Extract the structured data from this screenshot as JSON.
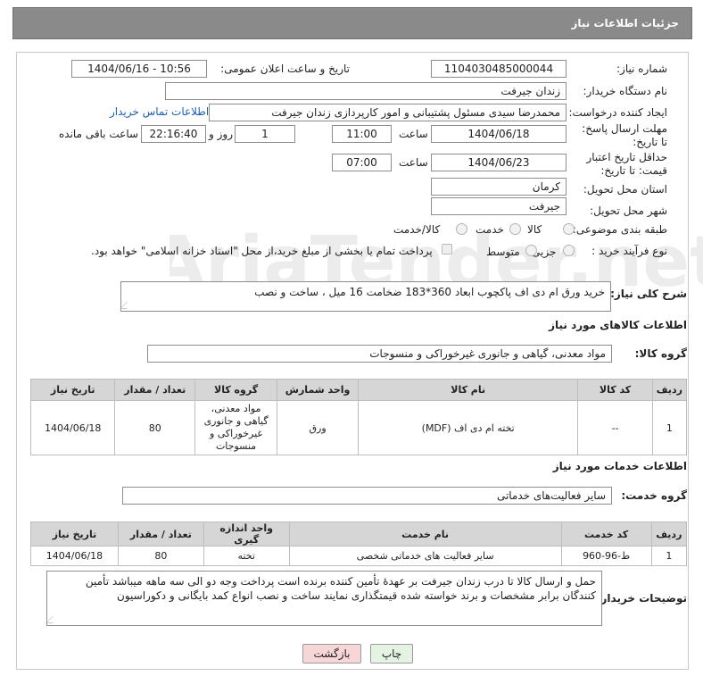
{
  "header": {
    "title": "جزئیات اطلاعات نیاز"
  },
  "form": {
    "need_number_label": "شماره نیاز:",
    "need_number": "1104030485000044",
    "announce_label": "تاریخ و ساعت اعلان عمومی:",
    "announce_value": "1404/06/16 - 10:56",
    "buyer_org_label": "نام دستگاه خریدار:",
    "buyer_org": "زندان جیرفت",
    "creator_label": "ایجاد کننده درخواست:",
    "creator": "محمدرضا سیدی مسئول پشتیبانی و امور کارپردازی زندان جیرفت",
    "contact_link": "اطلاعات تماس خریدار",
    "reply_deadline_label": "مهلت ارسال پاسخ: تا تاریخ:",
    "reply_date": "1404/06/18",
    "time_label": "ساعت",
    "reply_time": "11:00",
    "days_count": "1",
    "days_label": "روز و",
    "remaining_time": "22:16:40",
    "remaining_label": "ساعت باقی مانده",
    "price_validity_label": "حداقل تاریخ اعتبار قیمت: تا تاریخ:",
    "validity_date": "1404/06/23",
    "validity_time": "07:00",
    "province_label": "استان محل تحویل:",
    "province": "کرمان",
    "city_label": "شهر محل تحویل:",
    "city": "جیرفت",
    "category_label": "طبقه بندی موضوعی:",
    "category_options": [
      "کالا",
      "خدمت",
      "کالا/خدمت"
    ],
    "purchase_type_label": "نوع فرآیند خرید :",
    "purchase_options": [
      "جزیی",
      "متوسط"
    ],
    "payment_note": "پرداخت تمام یا بخشی از مبلغ خرید،از محل \"اسناد خزانه اسلامی\" خواهد بود.",
    "description_label": "شرح کلی نیاز:",
    "description": "خرید ورق ام دی اف پاکچوب ابعاد 360*183 ضخامت 16 میل ، ساخت و نصب"
  },
  "goods": {
    "section_title": "اطلاعات کالاهای مورد نیاز",
    "group_label": "گروه کالا:",
    "group_value": "مواد معدنی، گیاهی و جانوری غیرخوراکی و منسوجات",
    "headers": [
      "ردیف",
      "کد کالا",
      "نام کالا",
      "واحد شمارش",
      "گروه کالا",
      "تعداد / مقدار",
      "تاریخ نیاز"
    ],
    "rows": [
      [
        "1",
        "--",
        "تخته ام دی اف (MDF)",
        "ورق",
        "مواد معدنی، گیاهی و جانوری غیرخوراکی و منسوجات",
        "80",
        "1404/06/18"
      ]
    ]
  },
  "services": {
    "section_title": "اطلاعات خدمات مورد نیاز",
    "group_label": "گروه خدمت:",
    "group_value": "سایر فعالیت‌های خدماتی",
    "headers": [
      "ردیف",
      "کد خدمت",
      "نام خدمت",
      "واحد اندازه گیری",
      "تعداد / مقدار",
      "تاریخ نیاز"
    ],
    "rows": [
      [
        "1",
        "ط-96-960",
        "سایر فعالیت های خدماتی شخصی",
        "تخته",
        "80",
        "1404/06/18"
      ]
    ]
  },
  "buyer_notes": {
    "label": "توضیحات خریدار:",
    "text": "حمل و ارسال کالا تا درب زندان جیرفت بر عهدهٔ تأمین کننده برنده است پرداخت وجه دو الی سه ماهه میباشد تأمین کنندگان برابر مشخصات و برند خواسته شده قیمتگذاری نمایند ساخت و نصب انواع کمد بایگانی و دکوراسیون"
  },
  "buttons": {
    "print": "چاپ",
    "back": "بازگشت"
  },
  "colors": {
    "header_bg": "#8a8a8a",
    "back_btn_bg": "#f6d6d6",
    "print_btn_bg": "#e4f3e2",
    "link": "#1a5fb4"
  },
  "watermark_text": "AriaTender.net"
}
